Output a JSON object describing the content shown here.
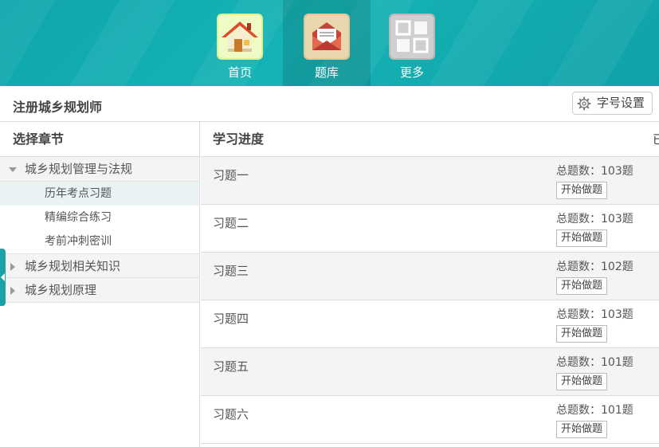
{
  "nav": {
    "items": [
      {
        "label": "首页",
        "icon": "home-icon",
        "active": false
      },
      {
        "label": "题库",
        "icon": "question-bank-icon",
        "active": true
      },
      {
        "label": "更多",
        "icon": "grid-icon",
        "active": false
      }
    ]
  },
  "titlebar": {
    "title": "注册城乡规划师",
    "font_setting_label": "字号设置"
  },
  "sidebar": {
    "heading": "选择章节",
    "chapters": [
      {
        "label": "城乡规划管理与法规",
        "expanded": true,
        "sections": [
          {
            "label": "历年考点习题",
            "active": true
          },
          {
            "label": "精编综合练习",
            "active": false
          },
          {
            "label": "考前冲刺密训",
            "active": false
          }
        ]
      },
      {
        "label": "城乡规划相关知识",
        "expanded": false,
        "sections": []
      },
      {
        "label": "城乡规划原理",
        "expanded": false,
        "sections": []
      }
    ]
  },
  "main": {
    "heading": "学习进度",
    "clipped_text": "已",
    "rows": [
      {
        "name": "习题一",
        "count": "总题数：103题",
        "button": "开始做题"
      },
      {
        "name": "习题二",
        "count": "总题数：103题",
        "button": "开始做题"
      },
      {
        "name": "习题三",
        "count": "总题数：102题",
        "button": "开始做题"
      },
      {
        "name": "习题四",
        "count": "总题数：103题",
        "button": "开始做题"
      },
      {
        "name": "习题五",
        "count": "总题数：101题",
        "button": "开始做题"
      },
      {
        "name": "习题六",
        "count": "总题数：101题",
        "button": "开始做题"
      }
    ]
  },
  "colors": {
    "accent": "#15b3b5",
    "active_section_bg": "#eaf3f3"
  }
}
